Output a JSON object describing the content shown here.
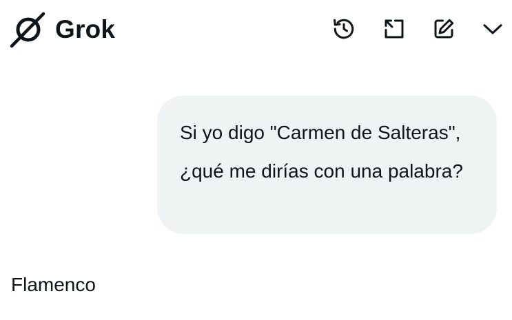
{
  "header": {
    "app_name": "Grok",
    "logo_icon": "grok-logo-icon",
    "actions": [
      {
        "name": "history",
        "icon": "history-icon"
      },
      {
        "name": "expand",
        "icon": "expand-icon"
      },
      {
        "name": "new-chat",
        "icon": "edit-icon"
      },
      {
        "name": "collapse",
        "icon": "chevron-down-icon"
      }
    ]
  },
  "conversation": {
    "user_message": "Si yo digo \"Carmen de Salteras\", ¿qué me dirías con una palabra?",
    "assistant_message": "Flamenco"
  },
  "colors": {
    "text": "#0f1419",
    "bubble_background": "#eff3f4",
    "background": "#ffffff"
  }
}
